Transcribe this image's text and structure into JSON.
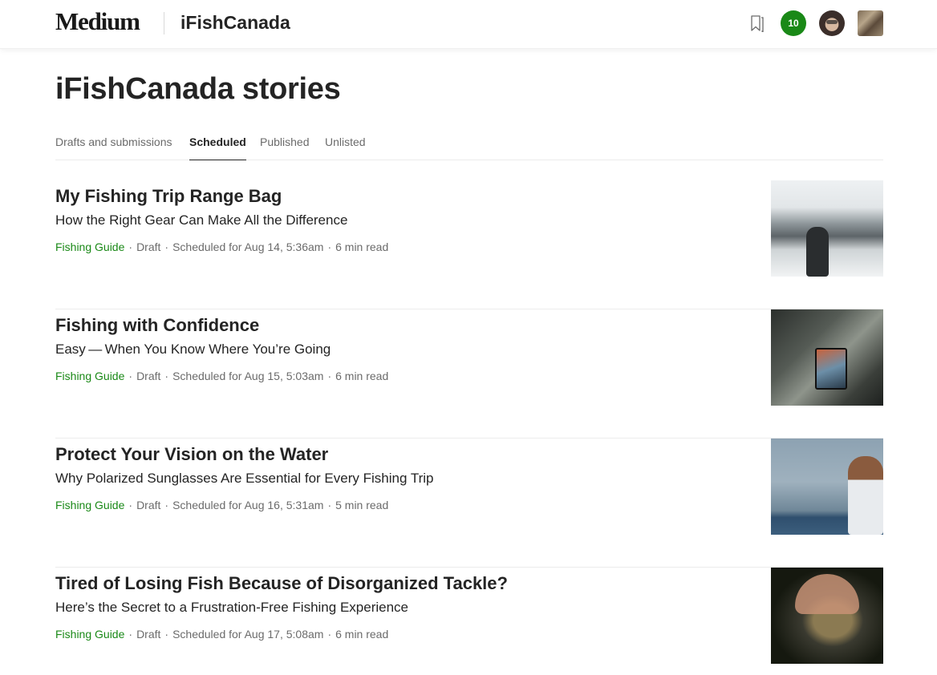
{
  "header": {
    "logo": "Medium",
    "publication": "iFishCanada",
    "notification_count": "10",
    "icons": {
      "bookmark": "bookmark-icon"
    }
  },
  "page": {
    "title": "iFishCanada stories"
  },
  "tabs": [
    {
      "label": "Drafts and submissions",
      "active": false
    },
    {
      "label": "Scheduled",
      "active": true
    },
    {
      "label": "Published",
      "active": false
    },
    {
      "label": "Unlisted",
      "active": false
    }
  ],
  "stories": [
    {
      "title": "My Fishing Trip Range Bag",
      "subtitle": "How the Right Gear Can Make All the Difference",
      "category": "Fishing Guide",
      "status": "Draft",
      "scheduled": "Scheduled for Aug 14, 5:36am",
      "read_time": "6 min read"
    },
    {
      "title": "Fishing with Confidence",
      "subtitle": "Easy — When You Know Where You’re Going",
      "category": "Fishing Guide",
      "status": "Draft",
      "scheduled": "Scheduled for Aug 15, 5:03am",
      "read_time": "6 min read"
    },
    {
      "title": "Protect Your Vision on the Water",
      "subtitle": "Why Polarized Sunglasses Are Essential for Every Fishing Trip",
      "category": "Fishing Guide",
      "status": "Draft",
      "scheduled": "Scheduled for Aug 16, 5:31am",
      "read_time": "5 min read"
    },
    {
      "title": "Tired of Losing Fish Because of Disorganized Tackle?",
      "subtitle": "Here’s the Secret to a Frustration-Free Fishing Experience",
      "category": "Fishing Guide",
      "status": "Draft",
      "scheduled": "Scheduled for Aug 17, 5:08am",
      "read_time": "6 min read"
    }
  ],
  "colors": {
    "accent_green": "#1a8917",
    "text": "#242424",
    "muted": "#6b6b6b"
  }
}
